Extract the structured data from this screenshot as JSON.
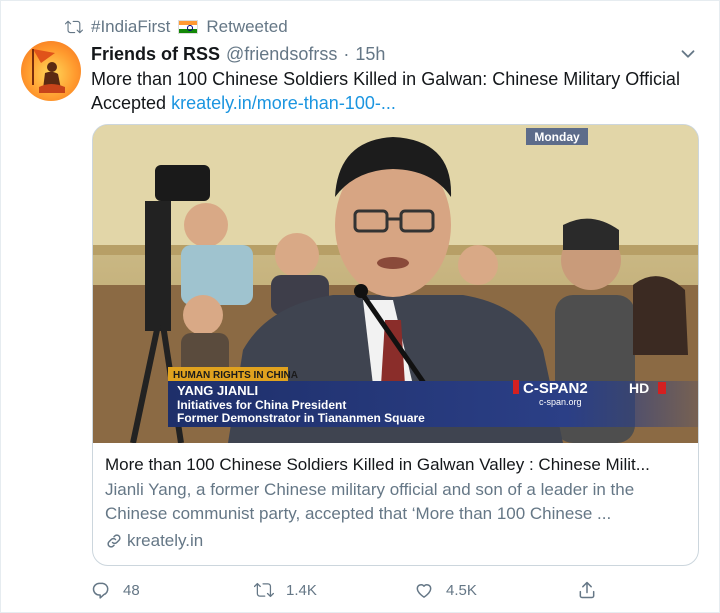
{
  "retweet": {
    "label": "#IndiaFirst",
    "suffix": "Retweeted",
    "icon": "retweet-icon",
    "flag": "india-flag"
  },
  "author": {
    "name": "Friends of RSS",
    "handle": "@friendsofrss",
    "dot": "·",
    "time": "15h",
    "avatar": "friends-of-rss-logo"
  },
  "tweet": {
    "text": "More than 100 Chinese Soldiers Killed in Galwan: Chinese Military Official Accepted",
    "link": "kreately.in/more-than-100-..."
  },
  "card": {
    "media": {
      "bug": "Monday",
      "lower_third": {
        "topic": "HUMAN RIGHTS IN CHINA",
        "name": "YANG JIANLI",
        "line1": "Initiatives for China President",
        "line2": "Former Demonstrator in Tiananmen Square"
      },
      "network": "C-SPAN2",
      "network_site": "c-span.org",
      "hd": "HD"
    },
    "title": "More than 100 Chinese Soldiers Killed in Galwan Valley : Chinese Milit...",
    "description": "Jianli Yang, a former Chinese military official and son of a leader in the Chinese communist party, accepted that ‘More than 100 Chinese ...",
    "domain": "kreately.in"
  },
  "actions": {
    "replies": "48",
    "retweets": "1.4K",
    "likes": "4.5K"
  },
  "colors": {
    "link": "#1b95e0",
    "secondary": "#657786",
    "border": "#ccd6dd"
  }
}
